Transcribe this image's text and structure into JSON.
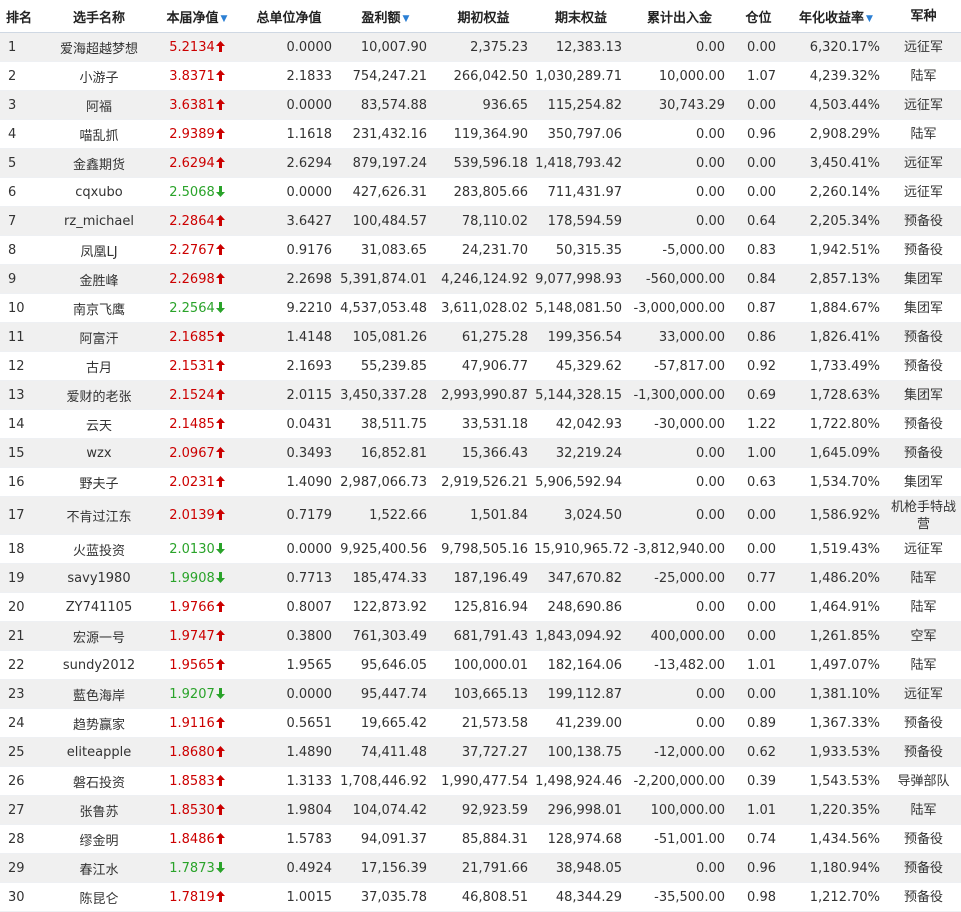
{
  "headers": [
    {
      "label": "排名",
      "sortable": false
    },
    {
      "label": "选手名称",
      "sortable": false
    },
    {
      "label": "本届净值",
      "sortable": true
    },
    {
      "label": "总单位净值",
      "sortable": false
    },
    {
      "label": "盈利额",
      "sortable": true
    },
    {
      "label": "期初权益",
      "sortable": false
    },
    {
      "label": "期末权益",
      "sortable": false
    },
    {
      "label": "累计出入金",
      "sortable": false
    },
    {
      "label": "仓位",
      "sortable": false
    },
    {
      "label": "年化收益率",
      "sortable": true
    },
    {
      "label": "军种",
      "sortable": false
    }
  ],
  "sort_indicator": "▼",
  "colors": {
    "up": "#cc0000",
    "down": "#2aa32a",
    "sort": "#2b7fd4",
    "row_alt": "#f0f0f0"
  },
  "icons": {
    "up": "red-arrow-up-icon",
    "down": "green-arrow-down-icon"
  },
  "rows": [
    {
      "rank": "1",
      "name": "爱海超越梦想",
      "net": "5.2134",
      "trend": "up",
      "unit_net": "0.0000",
      "profit": "10,007.90",
      "start_equity": "2,375.23",
      "end_equity": "12,383.13",
      "cash_flow": "0.00",
      "position": "0.00",
      "annual_return": "6,320.17%",
      "team": "远征军"
    },
    {
      "rank": "2",
      "name": "小游子",
      "net": "3.8371",
      "trend": "up",
      "unit_net": "2.1833",
      "profit": "754,247.21",
      "start_equity": "266,042.50",
      "end_equity": "1,030,289.71",
      "cash_flow": "10,000.00",
      "position": "1.07",
      "annual_return": "4,239.32%",
      "team": "陆军"
    },
    {
      "rank": "3",
      "name": "阿福",
      "net": "3.6381",
      "trend": "up",
      "unit_net": "0.0000",
      "profit": "83,574.88",
      "start_equity": "936.65",
      "end_equity": "115,254.82",
      "cash_flow": "30,743.29",
      "position": "0.00",
      "annual_return": "4,503.44%",
      "team": "远征军"
    },
    {
      "rank": "4",
      "name": "喵乱抓",
      "net": "2.9389",
      "trend": "up",
      "unit_net": "1.1618",
      "profit": "231,432.16",
      "start_equity": "119,364.90",
      "end_equity": "350,797.06",
      "cash_flow": "0.00",
      "position": "0.96",
      "annual_return": "2,908.29%",
      "team": "陆军"
    },
    {
      "rank": "5",
      "name": "金鑫期货",
      "net": "2.6294",
      "trend": "up",
      "unit_net": "2.6294",
      "profit": "879,197.24",
      "start_equity": "539,596.18",
      "end_equity": "1,418,793.42",
      "cash_flow": "0.00",
      "position": "0.00",
      "annual_return": "3,450.41%",
      "team": "远征军"
    },
    {
      "rank": "6",
      "name": "cqxubo",
      "net": "2.5068",
      "trend": "down",
      "unit_net": "0.0000",
      "profit": "427,626.31",
      "start_equity": "283,805.66",
      "end_equity": "711,431.97",
      "cash_flow": "0.00",
      "position": "0.00",
      "annual_return": "2,260.14%",
      "team": "远征军"
    },
    {
      "rank": "7",
      "name": "rz_michael",
      "net": "2.2864",
      "trend": "up",
      "unit_net": "3.6427",
      "profit": "100,484.57",
      "start_equity": "78,110.02",
      "end_equity": "178,594.59",
      "cash_flow": "0.00",
      "position": "0.64",
      "annual_return": "2,205.34%",
      "team": "预备役"
    },
    {
      "rank": "8",
      "name": "凤凰LJ",
      "net": "2.2767",
      "trend": "up",
      "unit_net": "0.9176",
      "profit": "31,083.65",
      "start_equity": "24,231.70",
      "end_equity": "50,315.35",
      "cash_flow": "-5,000.00",
      "position": "0.83",
      "annual_return": "1,942.51%",
      "team": "预备役"
    },
    {
      "rank": "9",
      "name": "金胜峰",
      "net": "2.2698",
      "trend": "up",
      "unit_net": "2.2698",
      "profit": "5,391,874.01",
      "start_equity": "4,246,124.92",
      "end_equity": "9,077,998.93",
      "cash_flow": "-560,000.00",
      "position": "0.84",
      "annual_return": "2,857.13%",
      "team": "集团军"
    },
    {
      "rank": "10",
      "name": "南京飞鹰",
      "net": "2.2564",
      "trend": "down",
      "unit_net": "9.2210",
      "profit": "4,537,053.48",
      "start_equity": "3,611,028.02",
      "end_equity": "5,148,081.50",
      "cash_flow": "-3,000,000.00",
      "position": "0.87",
      "annual_return": "1,884.67%",
      "team": "集团军"
    },
    {
      "rank": "11",
      "name": "阿富汗",
      "net": "2.1685",
      "trend": "up",
      "unit_net": "1.4148",
      "profit": "105,081.26",
      "start_equity": "61,275.28",
      "end_equity": "199,356.54",
      "cash_flow": "33,000.00",
      "position": "0.86",
      "annual_return": "1,826.41%",
      "team": "预备役"
    },
    {
      "rank": "12",
      "name": "古月",
      "net": "2.1531",
      "trend": "up",
      "unit_net": "2.1693",
      "profit": "55,239.85",
      "start_equity": "47,906.77",
      "end_equity": "45,329.62",
      "cash_flow": "-57,817.00",
      "position": "0.92",
      "annual_return": "1,733.49%",
      "team": "预备役"
    },
    {
      "rank": "13",
      "name": "爱财的老张",
      "net": "2.1524",
      "trend": "up",
      "unit_net": "2.0115",
      "profit": "3,450,337.28",
      "start_equity": "2,993,990.87",
      "end_equity": "5,144,328.15",
      "cash_flow": "-1,300,000.00",
      "position": "0.69",
      "annual_return": "1,728.63%",
      "team": "集团军"
    },
    {
      "rank": "14",
      "name": "云天",
      "net": "2.1485",
      "trend": "up",
      "unit_net": "0.0431",
      "profit": "38,511.75",
      "start_equity": "33,531.18",
      "end_equity": "42,042.93",
      "cash_flow": "-30,000.00",
      "position": "1.22",
      "annual_return": "1,722.80%",
      "team": "预备役"
    },
    {
      "rank": "15",
      "name": "wzx",
      "net": "2.0967",
      "trend": "up",
      "unit_net": "0.3493",
      "profit": "16,852.81",
      "start_equity": "15,366.43",
      "end_equity": "32,219.24",
      "cash_flow": "0.00",
      "position": "1.00",
      "annual_return": "1,645.09%",
      "team": "预备役"
    },
    {
      "rank": "16",
      "name": "野夫子",
      "net": "2.0231",
      "trend": "up",
      "unit_net": "1.4090",
      "profit": "2,987,066.73",
      "start_equity": "2,919,526.21",
      "end_equity": "5,906,592.94",
      "cash_flow": "0.00",
      "position": "0.63",
      "annual_return": "1,534.70%",
      "team": "集团军"
    },
    {
      "rank": "17",
      "name": "不肯过江东",
      "net": "2.0139",
      "trend": "up",
      "unit_net": "0.7179",
      "profit": "1,522.66",
      "start_equity": "1,501.84",
      "end_equity": "3,024.50",
      "cash_flow": "0.00",
      "position": "0.00",
      "annual_return": "1,586.92%",
      "team": "机枪手特战营",
      "tall": true
    },
    {
      "rank": "18",
      "name": "火蓝投资",
      "net": "2.0130",
      "trend": "down",
      "unit_net": "0.0000",
      "profit": "9,925,400.56",
      "start_equity": "9,798,505.16",
      "end_equity": "15,910,965.72",
      "cash_flow": "-3,812,940.00",
      "position": "0.00",
      "annual_return": "1,519.43%",
      "team": "远征军"
    },
    {
      "rank": "19",
      "name": "savy1980",
      "net": "1.9908",
      "trend": "down",
      "unit_net": "0.7713",
      "profit": "185,474.33",
      "start_equity": "187,196.49",
      "end_equity": "347,670.82",
      "cash_flow": "-25,000.00",
      "position": "0.77",
      "annual_return": "1,486.20%",
      "team": "陆军"
    },
    {
      "rank": "20",
      "name": "ZY741105",
      "net": "1.9766",
      "trend": "up",
      "unit_net": "0.8007",
      "profit": "122,873.92",
      "start_equity": "125,816.94",
      "end_equity": "248,690.86",
      "cash_flow": "0.00",
      "position": "0.00",
      "annual_return": "1,464.91%",
      "team": "陆军"
    },
    {
      "rank": "21",
      "name": "宏源一号",
      "net": "1.9747",
      "trend": "up",
      "unit_net": "0.3800",
      "profit": "761,303.49",
      "start_equity": "681,791.43",
      "end_equity": "1,843,094.92",
      "cash_flow": "400,000.00",
      "position": "0.00",
      "annual_return": "1,261.85%",
      "team": "空军"
    },
    {
      "rank": "22",
      "name": "sundy2012",
      "net": "1.9565",
      "trend": "up",
      "unit_net": "1.9565",
      "profit": "95,646.05",
      "start_equity": "100,000.01",
      "end_equity": "182,164.06",
      "cash_flow": "-13,482.00",
      "position": "1.01",
      "annual_return": "1,497.07%",
      "team": "陆军"
    },
    {
      "rank": "23",
      "name": "藍色海岸",
      "net": "1.9207",
      "trend": "down",
      "unit_net": "0.0000",
      "profit": "95,447.74",
      "start_equity": "103,665.13",
      "end_equity": "199,112.87",
      "cash_flow": "0.00",
      "position": "0.00",
      "annual_return": "1,381.10%",
      "team": "远征军"
    },
    {
      "rank": "24",
      "name": "趋势赢家",
      "net": "1.9116",
      "trend": "up",
      "unit_net": "0.5651",
      "profit": "19,665.42",
      "start_equity": "21,573.58",
      "end_equity": "41,239.00",
      "cash_flow": "0.00",
      "position": "0.89",
      "annual_return": "1,367.33%",
      "team": "预备役"
    },
    {
      "rank": "25",
      "name": "eliteapple",
      "net": "1.8680",
      "trend": "up",
      "unit_net": "1.4890",
      "profit": "74,411.48",
      "start_equity": "37,727.27",
      "end_equity": "100,138.75",
      "cash_flow": "-12,000.00",
      "position": "0.62",
      "annual_return": "1,933.53%",
      "team": "预备役"
    },
    {
      "rank": "26",
      "name": "磐石投资",
      "net": "1.8583",
      "trend": "up",
      "unit_net": "1.3133",
      "profit": "1,708,446.92",
      "start_equity": "1,990,477.54",
      "end_equity": "1,498,924.46",
      "cash_flow": "-2,200,000.00",
      "position": "0.39",
      "annual_return": "1,543.53%",
      "team": "导弹部队"
    },
    {
      "rank": "27",
      "name": "张鲁苏",
      "net": "1.8530",
      "trend": "up",
      "unit_net": "1.9804",
      "profit": "104,074.42",
      "start_equity": "92,923.59",
      "end_equity": "296,998.01",
      "cash_flow": "100,000.00",
      "position": "1.01",
      "annual_return": "1,220.35%",
      "team": "陆军"
    },
    {
      "rank": "28",
      "name": "缪金明",
      "net": "1.8486",
      "trend": "up",
      "unit_net": "1.5783",
      "profit": "94,091.37",
      "start_equity": "85,884.31",
      "end_equity": "128,974.68",
      "cash_flow": "-51,001.00",
      "position": "0.74",
      "annual_return": "1,434.56%",
      "team": "预备役"
    },
    {
      "rank": "29",
      "name": "春江水",
      "net": "1.7873",
      "trend": "down",
      "unit_net": "0.4924",
      "profit": "17,156.39",
      "start_equity": "21,791.66",
      "end_equity": "38,948.05",
      "cash_flow": "0.00",
      "position": "0.96",
      "annual_return": "1,180.94%",
      "team": "预备役"
    },
    {
      "rank": "30",
      "name": "陈昆仑",
      "net": "1.7819",
      "trend": "up",
      "unit_net": "1.0015",
      "profit": "37,035.78",
      "start_equity": "46,808.51",
      "end_equity": "48,344.29",
      "cash_flow": "-35,500.00",
      "position": "0.98",
      "annual_return": "1,212.70%",
      "team": "预备役"
    }
  ]
}
